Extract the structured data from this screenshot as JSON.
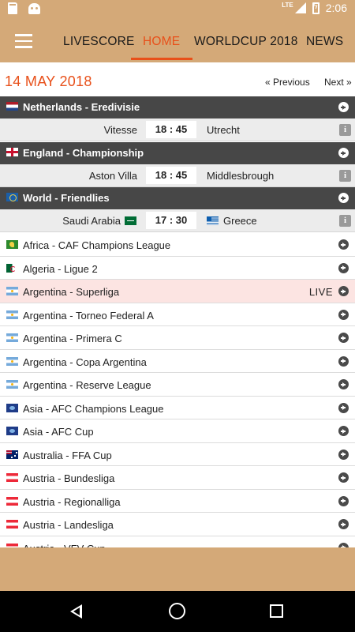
{
  "status_bar": {
    "network": "LTE",
    "time": "2:06",
    "left_icons": [
      "sd-card-icon",
      "android-icon"
    ],
    "right_icons": [
      "signal-icon",
      "battery-charging-icon"
    ]
  },
  "nav": {
    "menu_icon": "hamburger-menu-icon",
    "tabs": [
      {
        "label": "LIVESCORE",
        "active": false
      },
      {
        "label": "HOME",
        "active": true
      },
      {
        "label": "WORLDCUP 2018",
        "active": false
      },
      {
        "label": "NEWS",
        "active": false
      }
    ]
  },
  "date_row": {
    "date": "14 MAY 2018",
    "previous": "« Previous",
    "next": "Next »"
  },
  "featured": [
    {
      "league": "Netherlands - Eredivisie",
      "flag": "netherlands",
      "match": {
        "home": "Vitesse",
        "score": "18 : 45",
        "away": "Utrecht"
      }
    },
    {
      "league": "England - Championship",
      "flag": "england",
      "match": {
        "home": "Aston Villa",
        "score": "18 : 45",
        "away": "Middlesbrough"
      }
    },
    {
      "league": "World - Friendlies",
      "flag": "world",
      "match": {
        "home": "Saudi Arabia",
        "home_flag": "saudi-arabia",
        "score": "17 : 30",
        "away": "Greece",
        "away_flag": "greece"
      }
    }
  ],
  "info_icon": "i",
  "leagues": [
    {
      "name": "Africa - CAF Champions League",
      "flag": "africa"
    },
    {
      "name": "Algeria - Ligue 2",
      "flag": "algeria"
    },
    {
      "name": "Argentina - Superliga",
      "flag": "argentina",
      "live": "LIVE"
    },
    {
      "name": "Argentina - Torneo Federal A",
      "flag": "argentina"
    },
    {
      "name": "Argentina - Primera C",
      "flag": "argentina"
    },
    {
      "name": "Argentina - Copa Argentina",
      "flag": "argentina"
    },
    {
      "name": "Argentina - Reserve League",
      "flag": "argentina"
    },
    {
      "name": "Asia - AFC Champions League",
      "flag": "asia"
    },
    {
      "name": "Asia - AFC Cup",
      "flag": "asia"
    },
    {
      "name": "Australia - FFA Cup",
      "flag": "australia"
    },
    {
      "name": "Austria - Bundesliga",
      "flag": "austria"
    },
    {
      "name": "Austria - Regionalliga",
      "flag": "austria"
    },
    {
      "name": "Austria - Landesliga",
      "flag": "austria"
    },
    {
      "name": "Austria - VFV Cup",
      "flag": "austria"
    }
  ],
  "colors": {
    "accent": "#e8501a",
    "toolbar": "#d4a978",
    "league_header": "#474747",
    "live_row": "#fce4e2"
  },
  "system_nav": [
    "back-icon",
    "home-icon",
    "recents-icon"
  ]
}
